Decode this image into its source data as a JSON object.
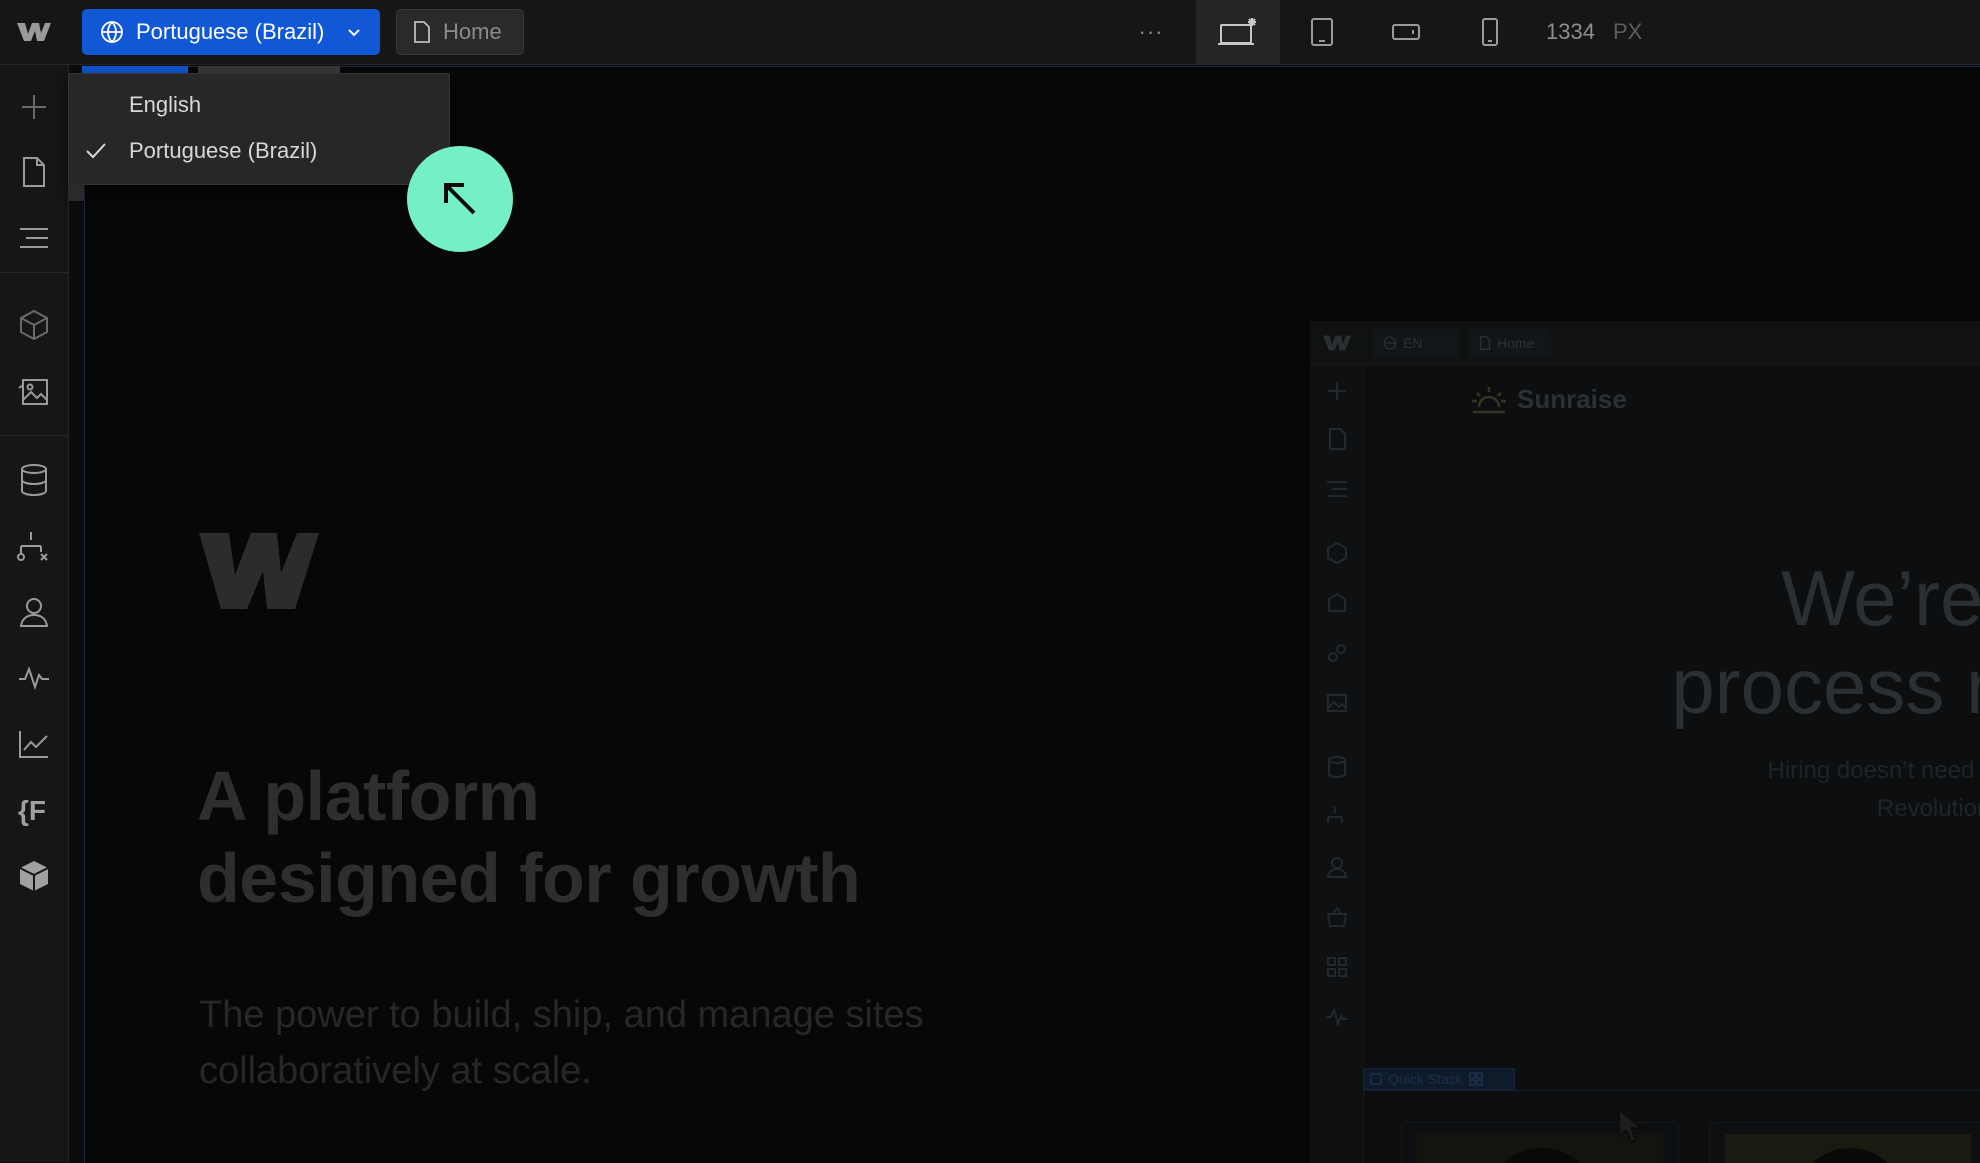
{
  "topbar": {
    "locale_label": "Portuguese (Brazil)",
    "page_label": "Home",
    "more_label": "···",
    "canvas_width": "1334",
    "canvas_unit": "PX",
    "breakpoints": [
      "Desktop",
      "Tablet",
      "Mobile landscape",
      "Mobile portrait"
    ]
  },
  "locale_menu": {
    "items": [
      {
        "label": "English",
        "selected": false
      },
      {
        "label": "Portuguese (Brazil)",
        "selected": true
      }
    ]
  },
  "sidebar": {
    "items": [
      "add",
      "pages",
      "navigator",
      "components",
      "assets",
      "cms",
      "logic",
      "users",
      "analyze",
      "insights",
      "variables",
      "apps"
    ]
  },
  "hero": {
    "title_line1": "A platform",
    "title_line2": "designed for growth",
    "subtitle": "The power to build, ship, and manage sites collaboratively at scale."
  },
  "preview": {
    "locale": "EN",
    "page": "Home",
    "more": "···",
    "brand": "Sunraise",
    "heading_line1": "We’re r",
    "heading_line2": "process m",
    "sub_line1": "Hiring doesn’t need to b",
    "sub_line2": "Revolutionize",
    "quick_stack": "Quick Stack"
  },
  "colors": {
    "accent": "#1058d6",
    "cursor_bubble": "#74f0c4",
    "topbar_bg": "#161616",
    "canvas_bg": "#070707"
  }
}
